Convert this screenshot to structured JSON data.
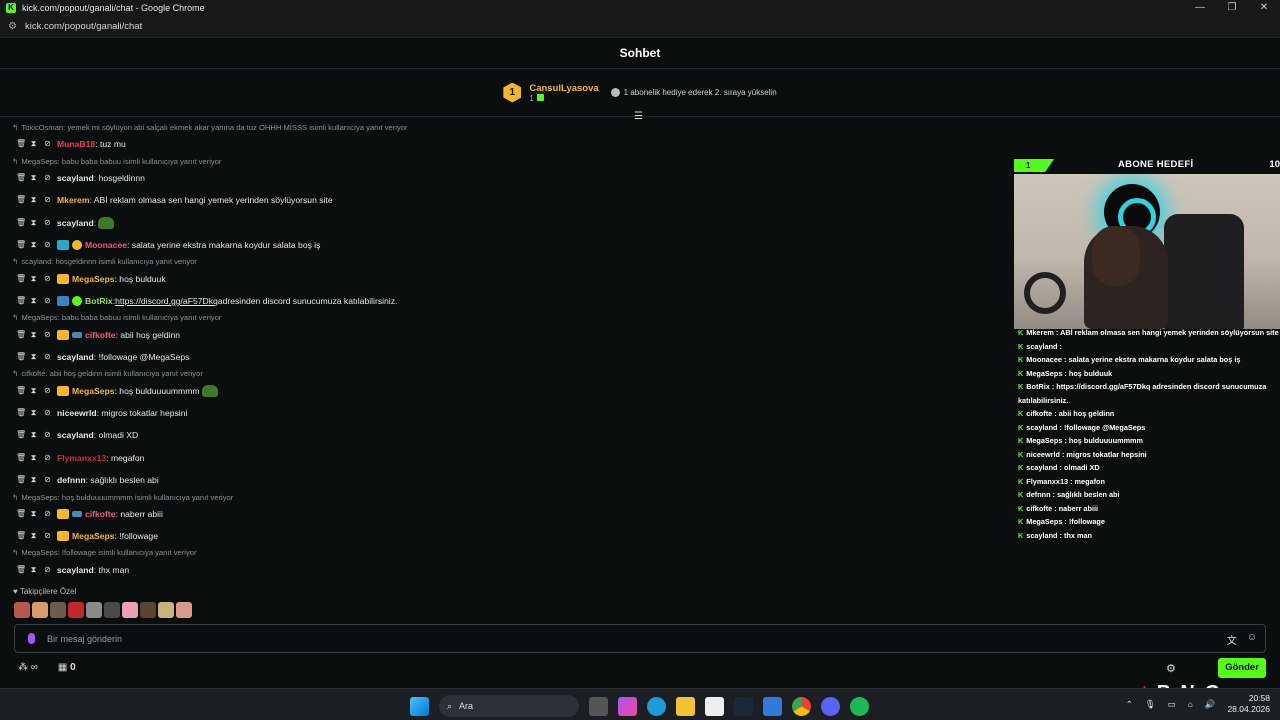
{
  "browser": {
    "title": "kick.com/popout/ganali/chat - Google Chrome",
    "url": "kick.com/popout/ganali/chat",
    "win_buttons": [
      "—",
      "❐",
      "✕"
    ]
  },
  "chat": {
    "header": "Sohbet",
    "pinned": {
      "rank": "1",
      "user": "CansulLyasova",
      "gifts": "1",
      "hint": "1 abonelik hediye ederek 2. sıraya yükselin"
    },
    "messages": [
      {
        "reply": "ToxicOsman: yemek mi söylüyon abi salçalı ekmek akar yanına da tuz OHHH MİSSS isimli kullanıcıya yanıt veriyor"
      },
      {
        "user": "MunaB18",
        "color": "#e0405a",
        "text": ": tuz mu"
      },
      {
        "reply": "MegaSeps: babu baba babuu isimli kullanıcıya yanıt veriyor"
      },
      {
        "user": "scayland",
        "color": "#e6e6e6",
        "text": ": hosgeldinnn"
      },
      {
        "user": "Mkerem",
        "color": "#f4b728",
        "text": ": ABİ reklam olmasa sen hangi yemek yerinden söylüyorsun site"
      },
      {
        "user": "scayland",
        "color": "#e6e6e6",
        "text": ":",
        "emote": true
      },
      {
        "user": "Moonacee",
        "color": "#f05a7e",
        "text": ": salata yerine ekstra makarna koydur salata boş iş",
        "badges": [
          "vip",
          "sub"
        ]
      },
      {
        "reply": "scayland: hosgeldinnn isimli kullanıcıya yanıt veriyor"
      },
      {
        "user": "MegaSeps",
        "color": "#f4b728",
        "text": ": hoş bulduuk",
        "badges": [
          "crown"
        ]
      },
      {
        "user": "BotRix",
        "color": "#9be05a",
        "text": "",
        "link": "https://discord.gg/aF57Dkq",
        "after": " adresinden discord sunucumuza katılabilirsiniz.",
        "badges": [
          "bot",
          "ver"
        ]
      },
      {
        "reply": "MegaSeps: babu baba babuu isimli kullanıcıya yanıt veriyor"
      },
      {
        "user": "cifkofte",
        "color": "#f05a7e",
        "text": ": abii hoş geldinn",
        "badges": [
          "crown",
          "fish"
        ]
      },
      {
        "user": "scayland",
        "color": "#e6e6e6",
        "text": ": !followage @MegaSeps"
      },
      {
        "reply": "cifkofte: abii hoş geldinn isimli kullanıcıya yanıt veriyor"
      },
      {
        "user": "MegaSeps",
        "color": "#f4b728",
        "text": ": hoş bulduuuummmm",
        "emote": true,
        "badges": [
          "crown"
        ]
      },
      {
        "user": "niceewrld",
        "color": "#e6e6e6",
        "text": ": migros tokatlar hepsini"
      },
      {
        "user": "scayland",
        "color": "#e6e6e6",
        "text": ": olmadi XD"
      },
      {
        "user": "Flymanxx13",
        "color": "#d02b3a",
        "text": ": megafon"
      },
      {
        "user": "defnnn",
        "color": "#e6e6e6",
        "text": ": sağlıklı beslen abi"
      },
      {
        "reply": "MegaSeps: hoş bulduuuummmm  isimli kullanıcıya yanıt veriyor"
      },
      {
        "user": "cifkofte",
        "color": "#f05a7e",
        "text": ": naberr abiii",
        "badges": [
          "crown",
          "fish"
        ]
      },
      {
        "user": "MegaSeps",
        "color": "#f4b728",
        "text": ": !followage",
        "badges": [
          "crown"
        ]
      },
      {
        "reply": "MegaSeps: !followage isimli kullanıcıya yanıt veriyor"
      },
      {
        "user": "scayland",
        "color": "#e6e6e6",
        "text": ": thx man"
      }
    ],
    "followers_only": "Takipçilere Özel",
    "input_placeholder": "Bir mesaj gönderin",
    "bottom_count": "0",
    "send": "Gönder"
  },
  "overlay": {
    "goal_current": "1",
    "goal_label": "ABONE HEDEFİ",
    "goal_target": "10",
    "messages": [
      "Mkerem : ABİ reklam olmasa sen hangi yemek yerinden söylüyorsun site",
      "scayland : ",
      "Moonacee : salata yerine ekstra makarna koydur salata boş iş",
      "MegaSeps : hoş bulduuk",
      "BotRix : https://discord.gg/aF57Dkq adresinden discord sunucumuza katılabilirsiniz.",
      "cifkofte : abii hoş geldinn",
      "scayland : !followage @MegaSeps",
      "MegaSeps : hoş bulduuuummmm",
      "niceewrld : migros tokatlar hepsini",
      "scayland : olmadi XD",
      "Flymanxx13 : megafon",
      "defnnn : sağlıklı beslen abi",
      "cifkofte : naberr abiii",
      "MegaSeps : !followage",
      "scayland : thx man"
    ],
    "brand": "ByNoGame"
  },
  "taskbar": {
    "search": "Ara",
    "time": "20:58",
    "date": "28.04.2026"
  }
}
